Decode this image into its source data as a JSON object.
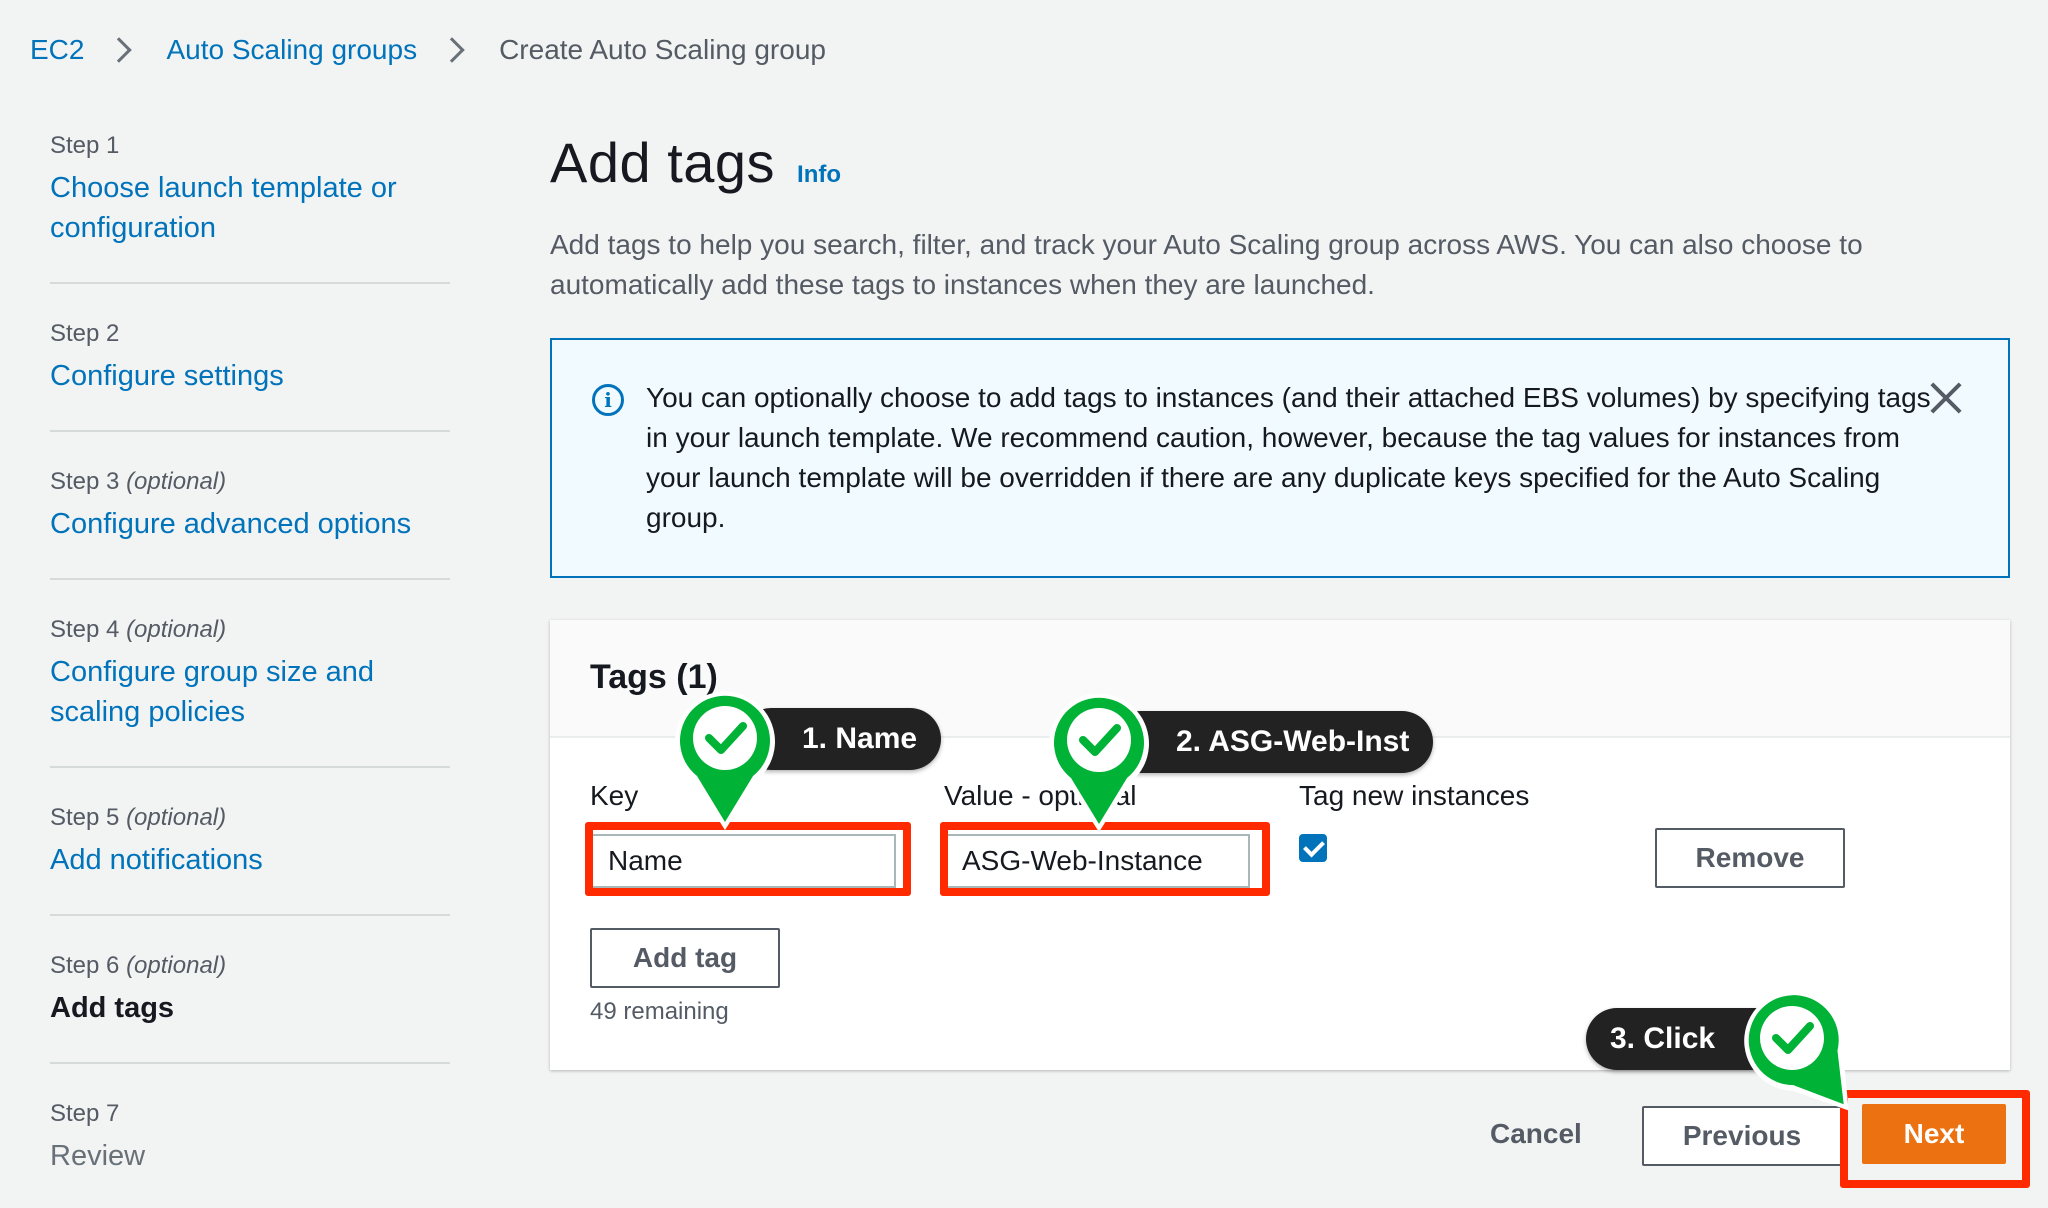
{
  "breadcrumb": {
    "items": [
      "EC2",
      "Auto Scaling groups"
    ],
    "current": "Create Auto Scaling group"
  },
  "steps": [
    {
      "num": "Step 1",
      "optional": "",
      "title": "Choose launch template or configuration"
    },
    {
      "num": "Step 2",
      "optional": "",
      "title": "Configure settings"
    },
    {
      "num": "Step 3",
      "optional": "(optional)",
      "title": "Configure advanced options"
    },
    {
      "num": "Step 4",
      "optional": "(optional)",
      "title": "Configure group size and scaling policies"
    },
    {
      "num": "Step 5",
      "optional": "(optional)",
      "title": "Add notifications"
    },
    {
      "num": "Step 6",
      "optional": "(optional)",
      "title": "Add tags"
    },
    {
      "num": "Step 7",
      "optional": "",
      "title": "Review"
    }
  ],
  "page": {
    "title": "Add tags",
    "info": "Info",
    "description": "Add tags to help you search, filter, and track your Auto Scaling group across AWS. You can also choose to automatically add these tags to instances when they are launched."
  },
  "alert": {
    "icon": "info-icon",
    "text": "You can optionally choose to add tags to instances (and their attached EBS volumes) by specifying tags in your launch template. We recommend caution, however, because the tag values for instances from your launch template will be overridden if there are any duplicate keys specified for the Auto Scaling group."
  },
  "tags": {
    "header": "Tags (1)",
    "key_label": "Key",
    "value_label": "Value - optional",
    "tag_new_label": "Tag new instances",
    "key_value": "Name",
    "value_value": "ASG-Web-Instance",
    "tag_new_checked": true,
    "remove_label": "Remove",
    "add_tag_label": "Add tag",
    "remaining": "49 remaining"
  },
  "footer": {
    "cancel": "Cancel",
    "previous": "Previous",
    "next": "Next"
  },
  "callouts": {
    "one": "1. Name",
    "two": "2. ASG-Web-Inst",
    "three": "3. Click"
  },
  "colors": {
    "link": "#0073bb",
    "primary": "#ec7211",
    "highlight": "#ff2a00",
    "pin": "#00b236"
  }
}
